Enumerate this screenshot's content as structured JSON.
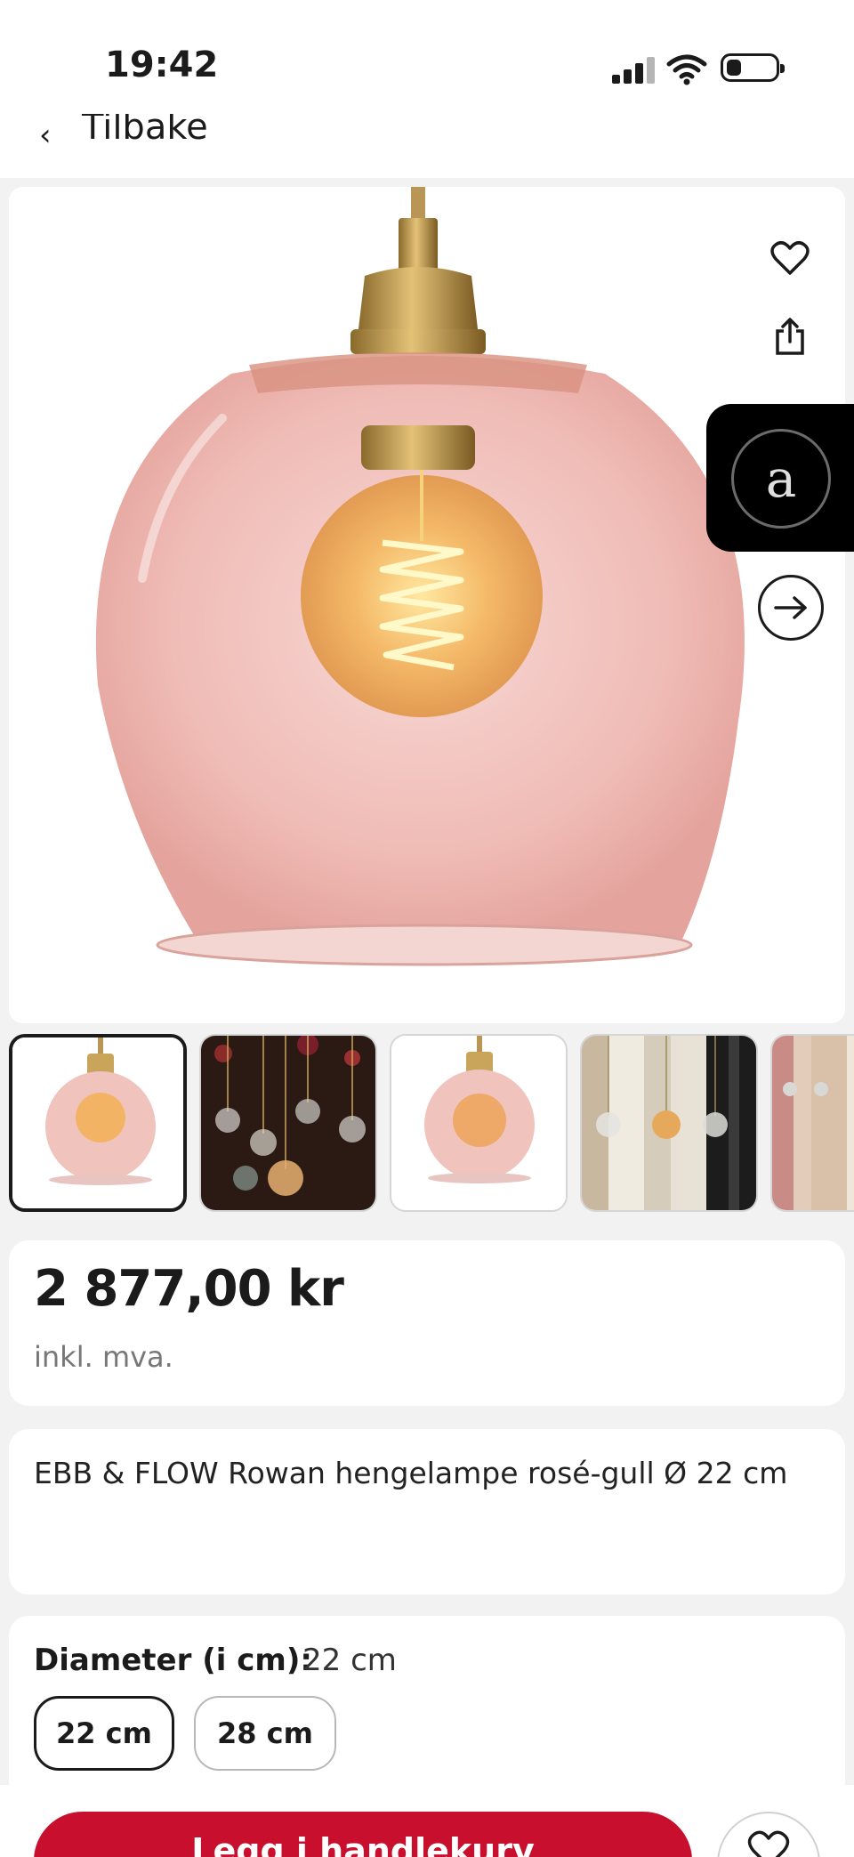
{
  "status_bar": {
    "time": "19:42"
  },
  "nav": {
    "back_label": "Tilbake"
  },
  "gallery": {
    "image_count": 5,
    "selected_index": 0
  },
  "product": {
    "price": "2 877,00 kr",
    "vat_note": "inkl. mva.",
    "title": "EBB & FLOW Rowan hengelampe rosé-gull Ø 22 cm"
  },
  "variant": {
    "label": "Diameter (i cm):",
    "selected_value": "22 cm",
    "options": [
      "22 cm",
      "28 cm"
    ]
  },
  "actions": {
    "add_to_cart_label": "Legg i handlekurv"
  },
  "colors": {
    "accent": "#c8102e",
    "text": "#1b1b1b",
    "muted": "#777777",
    "background": "#f2f2f3"
  }
}
